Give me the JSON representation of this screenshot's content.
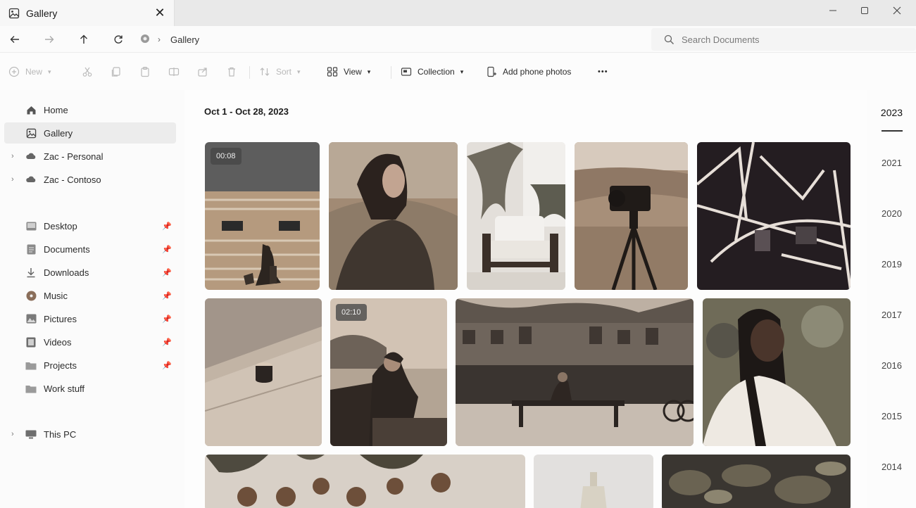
{
  "window": {
    "tab_title": "Gallery",
    "tab_icon": "gallery-icon",
    "controls": [
      "minimize",
      "maximize",
      "close"
    ]
  },
  "address": {
    "breadcrumb": "Gallery",
    "search_placeholder": "Search Documents"
  },
  "toolbar": {
    "new_label": "New",
    "sort_label": "Sort",
    "view_label": "View",
    "collection_label": "Collection",
    "add_phone_label": "Add phone photos",
    "more_label": "•••"
  },
  "sidebar": {
    "items": [
      {
        "label": "Home",
        "icon": "home-icon"
      },
      {
        "label": "Gallery",
        "icon": "gallery-icon",
        "selected": true
      },
      {
        "label": "Zac - Personal",
        "icon": "cloud-icon",
        "expandable": true
      },
      {
        "label": "Zac - Contoso",
        "icon": "cloud-icon",
        "expandable": true
      },
      {
        "label": "Desktop",
        "icon": "desktop-icon",
        "pinned": true
      },
      {
        "label": "Documents",
        "icon": "documents-icon",
        "pinned": true
      },
      {
        "label": "Downloads",
        "icon": "download-icon",
        "pinned": true
      },
      {
        "label": "Music",
        "icon": "music-icon",
        "pinned": true
      },
      {
        "label": "Pictures",
        "icon": "pictures-icon",
        "pinned": true
      },
      {
        "label": "Videos",
        "icon": "videos-icon",
        "pinned": true
      },
      {
        "label": "Projects",
        "icon": "folder-icon",
        "pinned": true
      },
      {
        "label": "Work stuff",
        "icon": "folder-icon"
      },
      {
        "label": "This PC",
        "icon": "pc-icon",
        "expandable": true
      }
    ]
  },
  "gallery": {
    "range_title": "Oct 1 - Oct 28, 2023",
    "photos": [
      {
        "subject": "building-wall-with-child-and-dog",
        "duration": "00:08"
      },
      {
        "subject": "woman-in-headscarf"
      },
      {
        "subject": "chair-and-plants"
      },
      {
        "subject": "camera-on-tripod"
      },
      {
        "subject": "abstract-lines-dark"
      },
      {
        "subject": "coffee-cup-on-table"
      },
      {
        "subject": "woman-sitting-by-lake",
        "duration": "02:10"
      },
      {
        "subject": "canal-street-with-bench"
      },
      {
        "subject": "smiling-woman-with-braids"
      },
      {
        "subject": "food-on-table"
      },
      {
        "subject": "bottle-on-white"
      },
      {
        "subject": "green-plants"
      }
    ]
  },
  "years": [
    "2023",
    "2021",
    "2020",
    "2019",
    "2017",
    "2016",
    "2015",
    "2014"
  ],
  "active_year": "2023"
}
